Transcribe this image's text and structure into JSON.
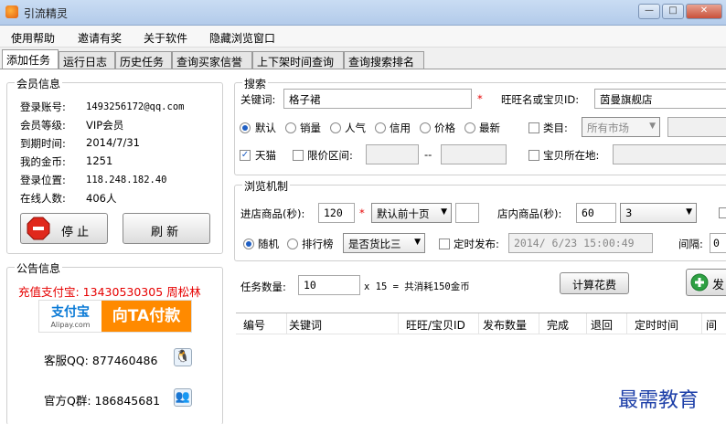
{
  "window": {
    "title": "引流精灵",
    "buttons": [
      "—",
      "□",
      "✕"
    ]
  },
  "menu": [
    "使用帮助",
    "邀请有奖",
    "关于软件",
    "隐藏浏览窗口"
  ],
  "tabs": [
    "添加任务",
    "运行日志",
    "历史任务",
    "查询买家信誉",
    "上下架时间查询",
    "查询搜索排名"
  ],
  "member": {
    "title": "会员信息",
    "rows": [
      {
        "label": "登录账号:",
        "value": "1493256172@qq.com"
      },
      {
        "label": "会员等级:",
        "value": "VIP会员"
      },
      {
        "label": "到期时间:",
        "value": "2014/7/31"
      },
      {
        "label": "我的金币:",
        "value": "1251"
      },
      {
        "label": "登录位置:",
        "value": "118.248.182.40"
      },
      {
        "label": "在线人数:",
        "value": "406人"
      }
    ],
    "stop_label": "停 止",
    "refresh_label": "刷 新"
  },
  "notice": {
    "title": "公告信息",
    "recharge": "充值支付宝: 13430530305 周松林",
    "alipay_logo": "支付宝",
    "alipay_sub": "Alipay.com",
    "pay_label": "向TA付款",
    "qq_service": "客服QQ: 877460486",
    "qq_group": "官方Q群: 186845681"
  },
  "search": {
    "title": "搜索",
    "keyword_label": "关键词:",
    "keyword_value": "格子裙",
    "required_mark": "*",
    "wangwang_label": "旺旺名或宝贝ID:",
    "wangwang_value": "茵曼旗舰店",
    "sort_options": [
      "默认",
      "销量",
      "人气",
      "信用",
      "价格",
      "最新"
    ],
    "category_label": "类目:",
    "category_value": "所有市场",
    "tmall_label": "天猫",
    "price_range_label": "限价区间:",
    "price_sep": "--",
    "location_label": "宝贝所在地:"
  },
  "browse": {
    "title": "浏览机制",
    "enter_label": "进店商品(秒):",
    "enter_value": "120",
    "page_select": "默认前十页",
    "instore_label": "店内商品(秒):",
    "instore_value": "60",
    "instore_count": "3",
    "mode_options": [
      "随机",
      "排行榜"
    ],
    "compare_select": "是否货比三",
    "schedule_label": "定时发布:",
    "schedule_value": "2014/ 6/23 15:00:49",
    "interval_label": "间隔:",
    "interval_value": "0"
  },
  "task": {
    "count_label": "任务数量:",
    "count_value": "10",
    "cost_text": "x 15 = 共消耗150金币",
    "calc_label": "计算花费",
    "publish_label": "发"
  },
  "table": {
    "columns": [
      "编号",
      "关键词",
      "旺旺/宝贝ID",
      "发布数量",
      "完成",
      "退回",
      "定时时间",
      "间隔"
    ]
  },
  "watermark": "最需教育"
}
